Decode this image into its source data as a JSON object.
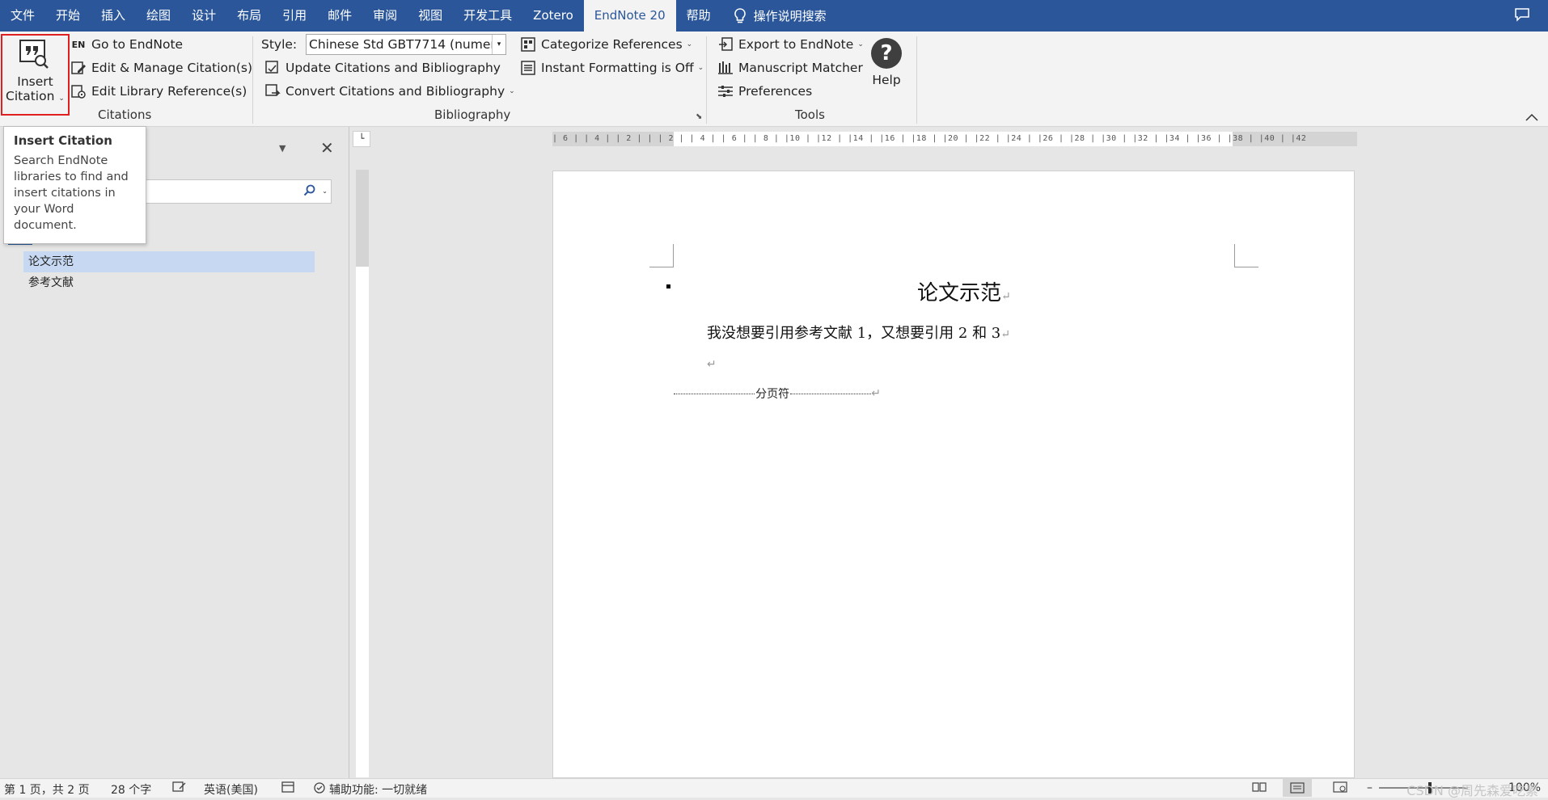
{
  "menubar": {
    "tabs": [
      {
        "label": "文件"
      },
      {
        "label": "开始"
      },
      {
        "label": "插入"
      },
      {
        "label": "绘图"
      },
      {
        "label": "设计"
      },
      {
        "label": "布局"
      },
      {
        "label": "引用"
      },
      {
        "label": "邮件"
      },
      {
        "label": "审阅"
      },
      {
        "label": "视图"
      },
      {
        "label": "开发工具"
      },
      {
        "label": "Zotero"
      },
      {
        "label": "EndNote 20"
      },
      {
        "label": "帮助"
      }
    ],
    "active_tab": "EndNote 20",
    "search_label": "操作说明搜索",
    "accent_color": "#2b579a"
  },
  "ribbon": {
    "citations": {
      "insert_citation_line1": "Insert",
      "insert_citation_line2": "Citation",
      "go_to_endnote": "Go to EndNote",
      "edit_manage": "Edit & Manage Citation(s)",
      "edit_library": "Edit Library Reference(s)",
      "group_label": "Citations"
    },
    "bibliography": {
      "style_label": "Style:",
      "style_value": "Chinese Std GBT7714 (numer...",
      "update": "Update Citations and Bibliography",
      "convert": "Convert Citations and Bibliography",
      "categorize": "Categorize References",
      "instant_formatting": "Instant Formatting is Off",
      "group_label": "Bibliography"
    },
    "tools": {
      "export": "Export to EndNote",
      "manuscript": "Manuscript Matcher",
      "preferences": "Preferences",
      "help": "Help",
      "group_label": "Tools"
    }
  },
  "tooltip": {
    "title": "Insert Citation",
    "body": "Search EndNote libraries to find and insert citations in your Word document."
  },
  "navpane": {
    "headings": [
      {
        "label": "论文示范",
        "selected": true
      },
      {
        "label": "参考文献",
        "selected": false
      }
    ]
  },
  "ruler": {
    "horizontal": "| 6 |   | 4 |   | 2 |   |   |   2 |   | 4 |   | 6 |   | 8 |   |10 |  |12 |  |14 |  |16 |  |18 |  |20 |  |22 |  |24 |  |26 |  |28 |  |30 |  |32 |  |34 |  |36 |  |38 |  |40 |  |42"
  },
  "document": {
    "title": "论文示范",
    "body": "我没想要引用参考文献 1，又想要引用 2 和 3",
    "page_break": "分页符",
    "para_mark": "↵"
  },
  "statusbar": {
    "page": "第 1 页，共 2 页",
    "words": "28 个字",
    "language": "英语(美国)",
    "accessibility": "辅助功能: 一切就绪",
    "zoom": "100%",
    "watermark": "CSDN @周先森爱吃素"
  }
}
